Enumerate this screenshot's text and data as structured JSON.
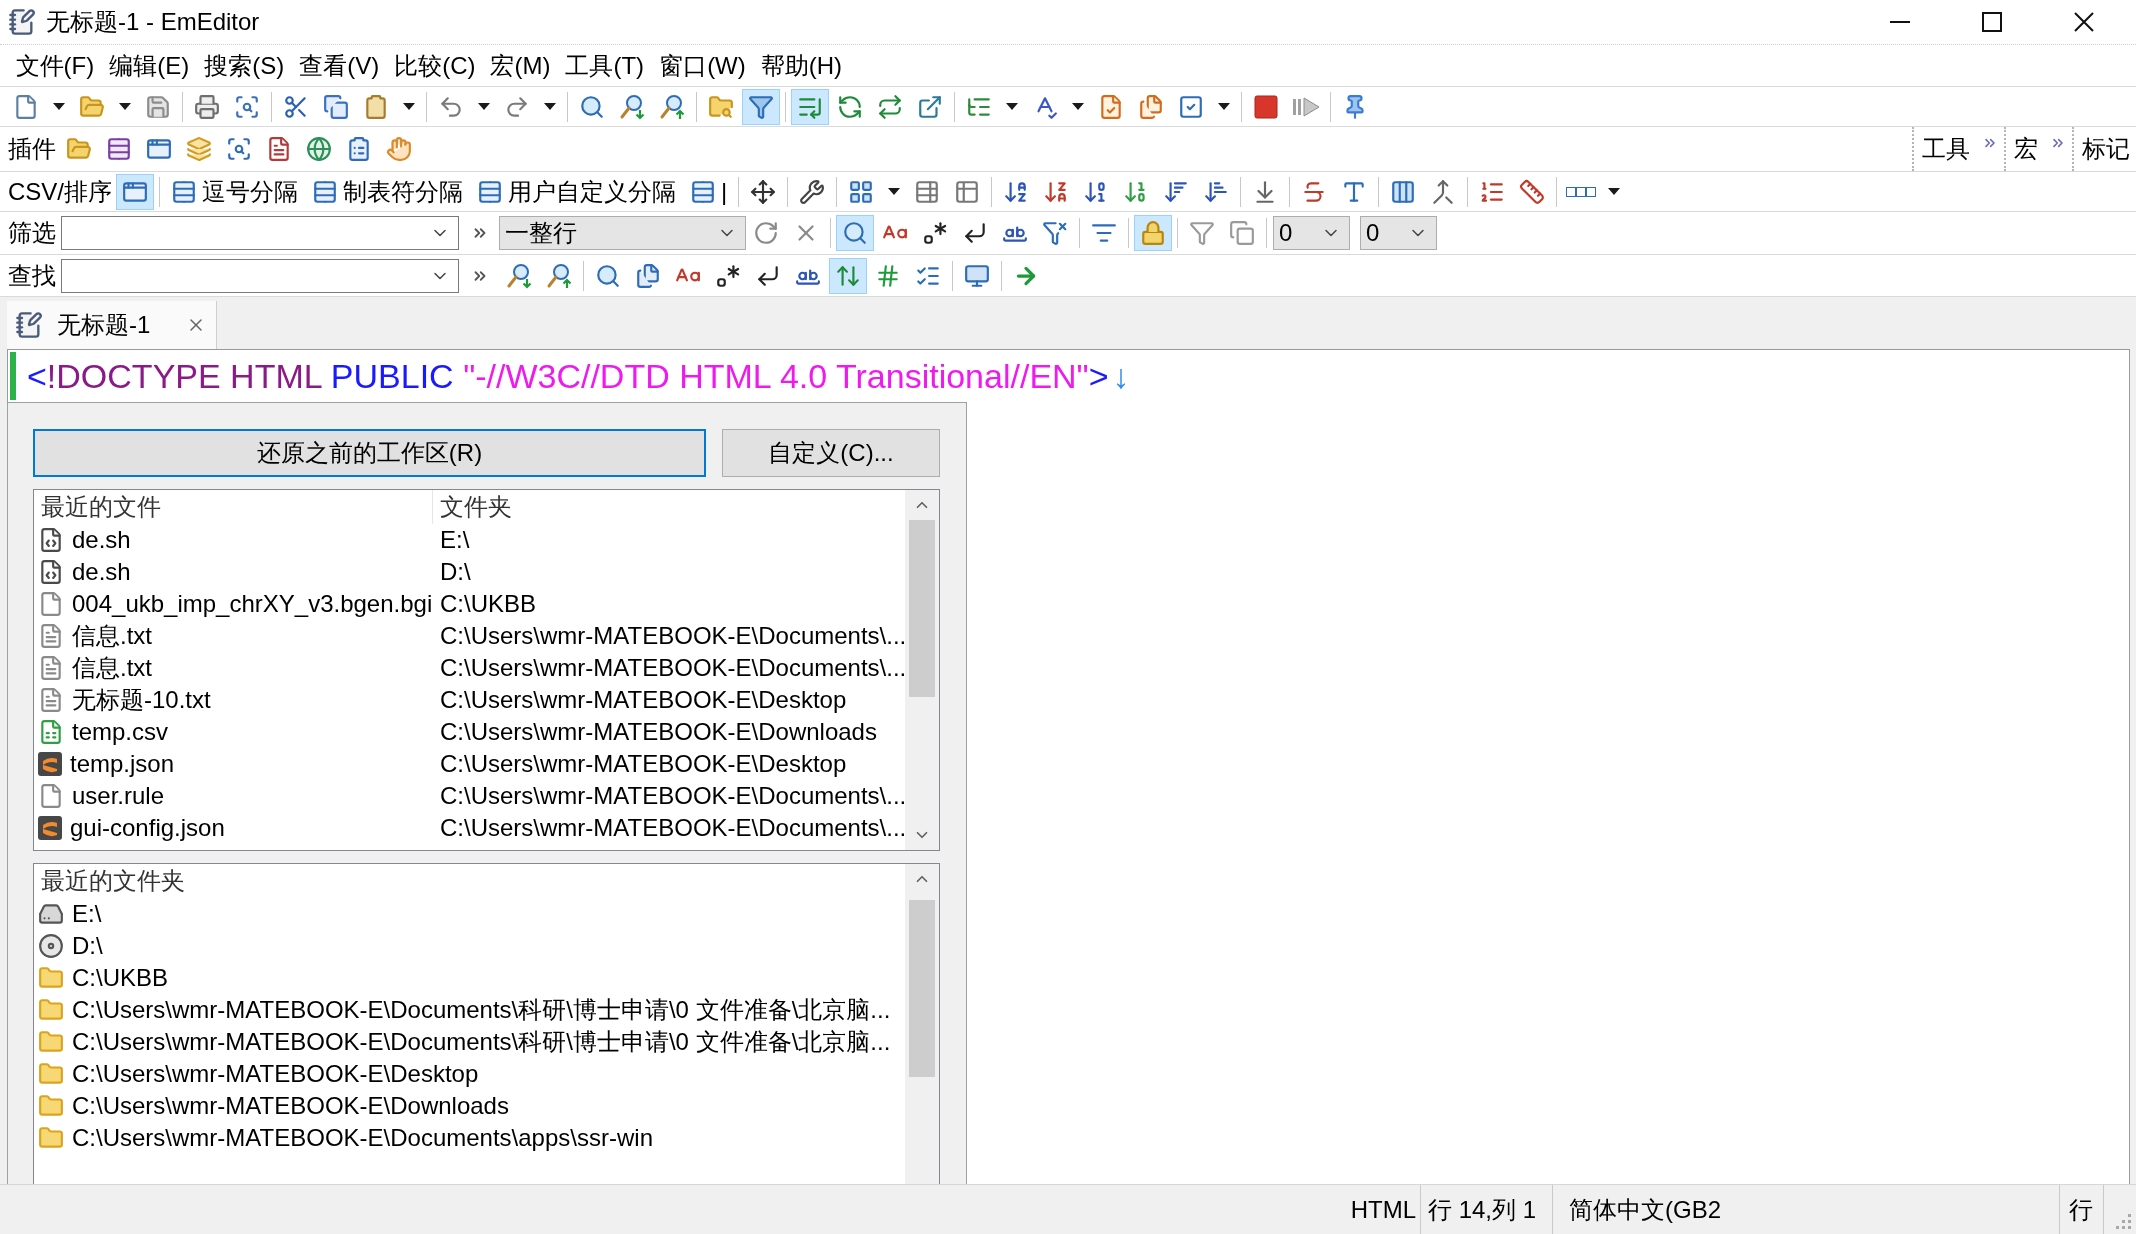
{
  "window": {
    "title": "无标题-1 - EmEditor"
  },
  "menu": [
    "文件(F)",
    "编辑(E)",
    "搜索(S)",
    "查看(V)",
    "比较(C)",
    "宏(M)",
    "工具(T)",
    "窗口(W)",
    "帮助(H)"
  ],
  "toolbar": {
    "groups": [
      [
        {
          "kind": "new",
          "pressed": false
        },
        {
          "kind": "caret",
          "pressed": false
        },
        {
          "kind": "open",
          "pressed": false
        },
        {
          "kind": "caret",
          "pressed": false
        },
        {
          "kind": "save",
          "pressed": false
        }
      ],
      [
        {
          "kind": "print",
          "pressed": false
        },
        {
          "kind": "preview",
          "pressed": false
        }
      ],
      [
        {
          "kind": "cut",
          "pressed": false
        },
        {
          "kind": "copy",
          "pressed": false
        },
        {
          "kind": "paste",
          "pressed": false
        },
        {
          "kind": "caret",
          "pressed": false
        }
      ],
      [
        {
          "kind": "undo",
          "pressed": false
        },
        {
          "kind": "caret",
          "pressed": false
        },
        {
          "kind": "redo",
          "pressed": false
        },
        {
          "kind": "caret",
          "pressed": false
        }
      ],
      [
        {
          "kind": "find",
          "pressed": false
        },
        {
          "kind": "searchdown",
          "pressed": false
        },
        {
          "kind": "searchup",
          "pressed": false
        }
      ],
      [
        {
          "kind": "findfiles",
          "pressed": false
        },
        {
          "kind": "filter",
          "pressed": true
        }
      ],
      [
        {
          "kind": "listend",
          "pressed": true
        },
        {
          "kind": "retab",
          "pressed": false
        },
        {
          "kind": "repeat",
          "pressed": false
        },
        {
          "kind": "jump",
          "pressed": false
        }
      ],
      [
        {
          "kind": "outline",
          "pressed": false
        },
        {
          "kind": "caret",
          "pressed": false
        },
        {
          "kind": "spell",
          "pressed": false
        },
        {
          "kind": "caret",
          "pressed": false
        },
        {
          "kind": "checkdoc",
          "pressed": false
        },
        {
          "kind": "checkdocs",
          "pressed": false
        },
        {
          "kind": "checklist",
          "pressed": false
        },
        {
          "kind": "caret",
          "pressed": false
        }
      ],
      [
        {
          "kind": "stop",
          "pressed": false
        },
        {
          "kind": "play",
          "pressed": false
        }
      ],
      [
        {
          "kind": "pin",
          "pressed": false
        }
      ]
    ]
  },
  "plugin_bar": {
    "label": "插件",
    "buttons": [
      {
        "kind": "pfolder"
      },
      {
        "kind": "ptable"
      },
      {
        "kind": "plist"
      },
      {
        "kind": "pwindows"
      },
      {
        "kind": "psearch"
      },
      {
        "kind": "pdoc"
      },
      {
        "kind": "pglobe"
      },
      {
        "kind": "pform"
      },
      {
        "kind": "phand"
      }
    ],
    "bands": [
      {
        "label": "工具",
        "more": true
      },
      {
        "label": "宏",
        "more": true
      },
      {
        "label": "标记",
        "more": false
      }
    ]
  },
  "csv_bar": {
    "label": "CSV/排序",
    "groups": [
      [
        {
          "kind": "csvmode",
          "pressed": true
        }
      ],
      [
        {
          "kind": "table",
          "text": "逗号分隔",
          "pressed": false
        },
        {
          "kind": "table",
          "text": "制表符分隔",
          "pressed": false
        },
        {
          "kind": "table",
          "text": "用户自定义分隔",
          "pressed": false
        },
        {
          "kind": "table",
          "text": "|",
          "pressed": false
        }
      ],
      [
        {
          "kind": "move",
          "pressed": false
        }
      ],
      [
        {
          "kind": "tools",
          "pressed": false
        }
      ],
      [
        {
          "kind": "grid",
          "pressed": false
        },
        {
          "kind": "caret",
          "pressed": false
        },
        {
          "kind": "rowedit",
          "pressed": false
        },
        {
          "kind": "coledit",
          "pressed": false
        }
      ],
      [
        {
          "kind": "sortaz",
          "pressed": false
        },
        {
          "kind": "sortza",
          "pressed": false
        },
        {
          "kind": "sort09",
          "pressed": false
        },
        {
          "kind": "sort90",
          "pressed": false
        },
        {
          "kind": "sortasc",
          "pressed": false
        },
        {
          "kind": "sortdesc",
          "pressed": false
        }
      ],
      [
        {
          "kind": "fixed",
          "pressed": false
        }
      ],
      [
        {
          "kind": "strike",
          "pressed": false
        },
        {
          "kind": "abcbox",
          "pressed": false
        }
      ],
      [
        {
          "kind": "split",
          "pressed": false
        },
        {
          "kind": "join",
          "pressed": false
        }
      ],
      [
        {
          "kind": "numlist",
          "pressed": false
        },
        {
          "kind": "ruler",
          "pressed": false
        }
      ],
      [
        {
          "kind": "boxes",
          "pressed": false
        },
        {
          "kind": "caret",
          "pressed": false
        }
      ]
    ]
  },
  "filter_bar": {
    "label": "筛选",
    "scope": "一整行",
    "groups": [
      [
        {
          "kind": "refresh",
          "pressed": false
        },
        {
          "kind": "close",
          "pressed": false
        }
      ],
      [
        {
          "kind": "find",
          "pressed": true
        },
        {
          "kind": "case",
          "pressed": false
        },
        {
          "kind": "regex",
          "pressed": false
        },
        {
          "kind": "escape",
          "pressed": false
        },
        {
          "kind": "word",
          "pressed": false
        },
        {
          "kind": "funnelx",
          "pressed": false
        }
      ],
      [
        {
          "kind": "filterwin",
          "pressed": false
        }
      ],
      [
        {
          "kind": "lock",
          "pressed": true
        }
      ],
      [
        {
          "kind": "fclear",
          "pressed": false
        },
        {
          "kind": "fcopy",
          "pressed": false
        }
      ]
    ],
    "numbers": [
      "0",
      "0"
    ]
  },
  "find_bar": {
    "label": "查找",
    "groups": [
      [
        {
          "kind": "searchdown",
          "pressed": false
        },
        {
          "kind": "searchup",
          "pressed": false
        }
      ],
      [
        {
          "kind": "find",
          "pressed": false
        },
        {
          "kind": "searchall",
          "pressed": false
        },
        {
          "kind": "case",
          "pressed": false
        },
        {
          "kind": "regex",
          "pressed": false
        },
        {
          "kind": "escape",
          "pressed": false
        },
        {
          "kind": "word",
          "pressed": false
        },
        {
          "kind": "updown",
          "pressed": true
        },
        {
          "kind": "hash",
          "pressed": false
        },
        {
          "kind": "bookmarks",
          "pressed": false
        }
      ],
      [
        {
          "kind": "screen",
          "pressed": false
        }
      ],
      [
        {
          "kind": "goto",
          "pressed": false
        }
      ]
    ]
  },
  "tabs": [
    {
      "title": "无标题-1",
      "selected": true
    }
  ],
  "editor": {
    "lines": [
      {
        "modified": true,
        "tokens": [
          {
            "kind": "punct",
            "text": "<"
          },
          {
            "kind": "tag",
            "text": "!DOCTYPE HTML "
          },
          {
            "kind": "keyword",
            "text": "PUBLIC "
          },
          {
            "kind": "string",
            "text": "\"-//W3C//DTD HTML 4.0 Transitional//EN\""
          },
          {
            "kind": "punct",
            "text": ">"
          }
        ],
        "eol": "↓"
      }
    ]
  },
  "start_panel": {
    "buttons": [
      {
        "label": "还原之前的工作区(R)",
        "default": true
      },
      {
        "label": "自定义(C)...",
        "default": false
      }
    ],
    "recent_files": {
      "columns": [
        "最近的文件",
        "文件夹"
      ],
      "rows": [
        {
          "kind": "script",
          "name": "de.sh",
          "folder": "E:\\"
        },
        {
          "kind": "script",
          "name": "de.sh",
          "folder": "D:\\"
        },
        {
          "kind": "blank",
          "name": "004_ukb_imp_chrXY_v3.bgen.bgi",
          "folder": "C:\\UKBB"
        },
        {
          "kind": "text",
          "name": "信息.txt",
          "folder": "C:\\Users\\wmr-MATEBOOK-E\\Documents\\..."
        },
        {
          "kind": "text",
          "name": "信息.txt",
          "folder": "C:\\Users\\wmr-MATEBOOK-E\\Documents\\..."
        },
        {
          "kind": "text",
          "name": "无标题-10.txt",
          "folder": "C:\\Users\\wmr-MATEBOOK-E\\Desktop"
        },
        {
          "kind": "csv",
          "name": "temp.csv",
          "folder": "C:\\Users\\wmr-MATEBOOK-E\\Downloads"
        },
        {
          "kind": "sublime",
          "name": "temp.json",
          "folder": "C:\\Users\\wmr-MATEBOOK-E\\Desktop"
        },
        {
          "kind": "blank",
          "name": "user.rule",
          "folder": "C:\\Users\\wmr-MATEBOOK-E\\Documents\\..."
        },
        {
          "kind": "sublime",
          "name": "gui-config.json",
          "folder": "C:\\Users\\wmr-MATEBOOK-E\\Documents\\..."
        }
      ]
    },
    "recent_folders": {
      "title": "最近的文件夹",
      "rows": [
        {
          "kind": "drive",
          "path": "E:\\"
        },
        {
          "kind": "dvd",
          "path": "D:\\"
        },
        {
          "kind": "folder",
          "path": "C:\\UKBB"
        },
        {
          "kind": "folder",
          "path": "C:\\Users\\wmr-MATEBOOK-E\\Documents\\科研\\博士申请\\0 文件准备\\北京脑..."
        },
        {
          "kind": "folder",
          "path": "C:\\Users\\wmr-MATEBOOK-E\\Documents\\科研\\博士申请\\0 文件准备\\北京脑..."
        },
        {
          "kind": "folder",
          "path": "C:\\Users\\wmr-MATEBOOK-E\\Desktop"
        },
        {
          "kind": "folder",
          "path": "C:\\Users\\wmr-MATEBOOK-E\\Downloads"
        },
        {
          "kind": "folder",
          "path": "C:\\Users\\wmr-MATEBOOK-E\\Documents\\apps\\ssr-win"
        }
      ]
    }
  },
  "status_bar": [
    "HTML",
    "行 14,列 1",
    "简体中文(GB2",
    "行"
  ]
}
